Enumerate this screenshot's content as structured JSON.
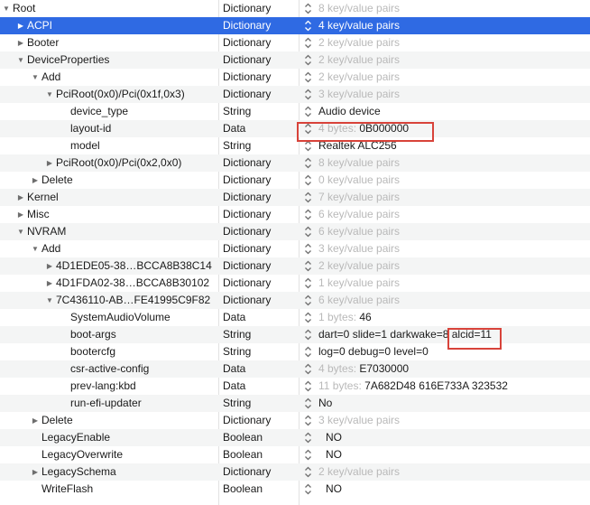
{
  "colors": {
    "selection": "#2f6ae3",
    "highlight_box": "#d8433a",
    "muted_text": "#b9b9b9"
  },
  "icons": {
    "expanded": "disclosure-expanded-icon",
    "collapsed": "disclosure-collapsed-icon",
    "stepper": "stepper-icon"
  },
  "rows": [
    {
      "key": "Root",
      "type": "Dictionary",
      "value_prefix": "8 key/value pairs",
      "value_main": "",
      "level": 0,
      "disclosure": "expanded"
    },
    {
      "key": "ACPI",
      "type": "Dictionary",
      "value_prefix": "",
      "value_main": "4 key/value pairs",
      "level": 1,
      "disclosure": "collapsed",
      "selected": true
    },
    {
      "key": "Booter",
      "type": "Dictionary",
      "value_prefix": "2 key/value pairs",
      "value_main": "",
      "level": 1,
      "disclosure": "collapsed"
    },
    {
      "key": "DeviceProperties",
      "type": "Dictionary",
      "value_prefix": "2 key/value pairs",
      "value_main": "",
      "level": 1,
      "disclosure": "expanded"
    },
    {
      "key": "Add",
      "type": "Dictionary",
      "value_prefix": "2 key/value pairs",
      "value_main": "",
      "level": 2,
      "disclosure": "expanded"
    },
    {
      "key": "PciRoot(0x0)/Pci(0x1f,0x3)",
      "type": "Dictionary",
      "value_prefix": "3 key/value pairs",
      "value_main": "",
      "level": 3,
      "disclosure": "expanded"
    },
    {
      "key": "device_type",
      "type": "String",
      "value_prefix": "",
      "value_main": "Audio device",
      "level": 4,
      "disclosure": "none"
    },
    {
      "key": "layout-id",
      "type": "Data",
      "value_prefix": "4 bytes: ",
      "value_main": "0B000000",
      "level": 4,
      "disclosure": "none"
    },
    {
      "key": "model",
      "type": "String",
      "value_prefix": "",
      "value_main": "Realtek ALC256",
      "level": 4,
      "disclosure": "none"
    },
    {
      "key": "PciRoot(0x0)/Pci(0x2,0x0)",
      "type": "Dictionary",
      "value_prefix": "8 key/value pairs",
      "value_main": "",
      "level": 3,
      "disclosure": "collapsed"
    },
    {
      "key": "Delete",
      "type": "Dictionary",
      "value_prefix": "0 key/value pairs",
      "value_main": "",
      "level": 2,
      "disclosure": "collapsed"
    },
    {
      "key": "Kernel",
      "type": "Dictionary",
      "value_prefix": "7 key/value pairs",
      "value_main": "",
      "level": 1,
      "disclosure": "collapsed"
    },
    {
      "key": "Misc",
      "type": "Dictionary",
      "value_prefix": "6 key/value pairs",
      "value_main": "",
      "level": 1,
      "disclosure": "collapsed"
    },
    {
      "key": "NVRAM",
      "type": "Dictionary",
      "value_prefix": "6 key/value pairs",
      "value_main": "",
      "level": 1,
      "disclosure": "expanded"
    },
    {
      "key": "Add",
      "type": "Dictionary",
      "value_prefix": "3 key/value pairs",
      "value_main": "",
      "level": 2,
      "disclosure": "expanded"
    },
    {
      "key": "4D1EDE05-38…BCCA8B38C14",
      "type": "Dictionary",
      "value_prefix": "2 key/value pairs",
      "value_main": "",
      "level": 3,
      "disclosure": "collapsed"
    },
    {
      "key": "4D1FDA02-38…BCCA8B30102",
      "type": "Dictionary",
      "value_prefix": "1 key/value pairs",
      "value_main": "",
      "level": 3,
      "disclosure": "collapsed"
    },
    {
      "key": "7C436110-AB…FE41995C9F82",
      "type": "Dictionary",
      "value_prefix": "6 key/value pairs",
      "value_main": "",
      "level": 3,
      "disclosure": "expanded"
    },
    {
      "key": "SystemAudioVolume",
      "type": "Data",
      "value_prefix": "1 bytes: ",
      "value_main": "46",
      "level": 4,
      "disclosure": "none"
    },
    {
      "key": "boot-args",
      "type": "String",
      "value_prefix": "",
      "value_main": "dart=0 slide=1 darkwake=8 alcid=11",
      "level": 4,
      "disclosure": "none"
    },
    {
      "key": "bootercfg",
      "type": "String",
      "value_prefix": "",
      "value_main": "log=0 debug=0 level=0",
      "level": 4,
      "disclosure": "none"
    },
    {
      "key": "csr-active-config",
      "type": "Data",
      "value_prefix": "4 bytes: ",
      "value_main": "E7030000",
      "level": 4,
      "disclosure": "none"
    },
    {
      "key": "prev-lang:kbd",
      "type": "Data",
      "value_prefix": "11 bytes: ",
      "value_main": "7A682D48 616E733A 323532",
      "level": 4,
      "disclosure": "none"
    },
    {
      "key": "run-efi-updater",
      "type": "String",
      "value_prefix": "",
      "value_main": "No",
      "level": 4,
      "disclosure": "none"
    },
    {
      "key": "Delete",
      "type": "Dictionary",
      "value_prefix": "3 key/value pairs",
      "value_main": "",
      "level": 2,
      "disclosure": "collapsed"
    },
    {
      "key": "LegacyEnable",
      "type": "Boolean",
      "value_prefix": "",
      "value_main": "NO",
      "level": 2,
      "disclosure": "none",
      "boolean": true
    },
    {
      "key": "LegacyOverwrite",
      "type": "Boolean",
      "value_prefix": "",
      "value_main": "NO",
      "level": 2,
      "disclosure": "none",
      "boolean": true
    },
    {
      "key": "LegacySchema",
      "type": "Dictionary",
      "value_prefix": "2 key/value pairs",
      "value_main": "",
      "level": 2,
      "disclosure": "collapsed"
    },
    {
      "key": "WriteFlash",
      "type": "Boolean",
      "value_prefix": "",
      "value_main": "NO",
      "level": 2,
      "disclosure": "none",
      "boolean": true
    }
  ]
}
